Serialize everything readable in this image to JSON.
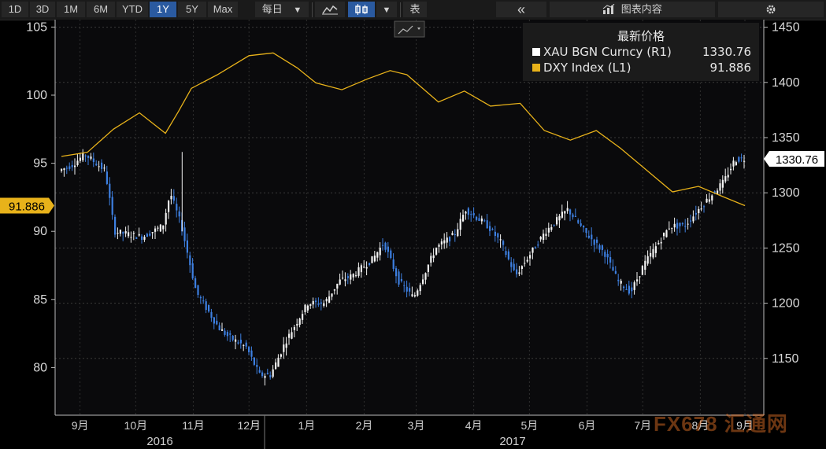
{
  "toolbar": {
    "ranges": [
      "1D",
      "3D",
      "1M",
      "6M",
      "YTD",
      "1Y",
      "5Y",
      "Max"
    ],
    "active_range": "1Y",
    "frequency": "每日",
    "dropdown_glyph": "▼",
    "table_label": "表",
    "collapse_glyph": "«",
    "chart_contents_label": "图表内容",
    "icons": [
      "line-chart-icon",
      "candlestick-icon",
      "chart-contents-icon",
      "settings-gear-icon"
    ]
  },
  "legend": {
    "title": "最新价格",
    "entries": [
      {
        "name": "XAU BGN Curncy  (R1)",
        "value": "1330.76",
        "color": "#ffffff"
      },
      {
        "name": "DXY Index  (L1)",
        "value": "91.886",
        "color": "#e8b21a"
      }
    ]
  },
  "watermark": "FX678 汇通网",
  "chart_data": {
    "type": "line",
    "left_axis": {
      "ticks": [
        80,
        85,
        90,
        95,
        100,
        105
      ],
      "range": [
        77,
        106
      ]
    },
    "right_axis": {
      "ticks": [
        1150,
        1200,
        1250,
        1300,
        1350,
        1400,
        1450
      ],
      "range": [
        1120,
        1460
      ]
    },
    "x_tick_labels": [
      "9月",
      "10月",
      "11月",
      "12月",
      "1月",
      "2月",
      "3月",
      "4月",
      "5月",
      "6月",
      "7月",
      "8月",
      "9月"
    ],
    "year_labels": [
      "2016",
      "2017"
    ],
    "left_last_label": "91.886",
    "right_last_label": "1330.76",
    "series": [
      {
        "name": "DXY Index  (L1)",
        "axis": "left",
        "color": "#e8b21a",
        "x": [
          "2016-09-05",
          "2016-09-19",
          "2016-10-03",
          "2016-10-17",
          "2016-10-31",
          "2016-11-07",
          "2016-11-14",
          "2016-11-28",
          "2016-12-15",
          "2016-12-28",
          "2017-01-10",
          "2017-01-20",
          "2017-02-03",
          "2017-02-17",
          "2017-03-01",
          "2017-03-10",
          "2017-03-27",
          "2017-04-10",
          "2017-04-24",
          "2017-05-10",
          "2017-05-23",
          "2017-06-06",
          "2017-06-20",
          "2017-07-03",
          "2017-07-17",
          "2017-07-31",
          "2017-08-14",
          "2017-08-28",
          "2017-09-08"
        ],
        "y": [
          95.5,
          95.8,
          97.5,
          98.7,
          97.2,
          98.8,
          100.5,
          101.5,
          102.9,
          103.1,
          102.0,
          100.9,
          100.4,
          101.2,
          101.8,
          101.5,
          99.5,
          100.3,
          99.2,
          99.4,
          97.4,
          96.7,
          97.4,
          96.1,
          94.5,
          92.9,
          93.3,
          92.5,
          91.886
        ]
      },
      {
        "name": "XAU BGN Curncy  (R1)",
        "axis": "right",
        "color": "#ffffff",
        "x": [
          "2016-09-05",
          "2016-09-12",
          "2016-09-19",
          "2016-09-30",
          "2016-10-05",
          "2016-10-20",
          "2016-10-31",
          "2016-11-04",
          "2016-11-10",
          "2016-11-18",
          "2016-11-30",
          "2016-12-05",
          "2016-12-15",
          "2016-12-22",
          "2016-12-28",
          "2017-01-05",
          "2017-01-17",
          "2017-01-26",
          "2017-02-03",
          "2017-02-10",
          "2017-02-21",
          "2017-02-27",
          "2017-03-07",
          "2017-03-15",
          "2017-03-27",
          "2017-04-06",
          "2017-04-12",
          "2017-04-24",
          "2017-05-01",
          "2017-05-09",
          "2017-05-17",
          "2017-05-25",
          "2017-06-06",
          "2017-06-15",
          "2017-06-26",
          "2017-07-03",
          "2017-07-10",
          "2017-07-17",
          "2017-07-31",
          "2017-08-08",
          "2017-08-18",
          "2017-08-29",
          "2017-09-04",
          "2017-09-08"
        ],
        "y": [
          1320,
          1325,
          1335,
          1320,
          1265,
          1260,
          1270,
          1300,
          1270,
          1210,
          1178,
          1170,
          1160,
          1135,
          1135,
          1165,
          1200,
          1200,
          1220,
          1225,
          1240,
          1255,
          1220,
          1205,
          1250,
          1262,
          1285,
          1270,
          1255,
          1225,
          1245,
          1265,
          1285,
          1265,
          1245,
          1220,
          1210,
          1235,
          1270,
          1270,
          1290,
          1310,
          1330,
          1330.76
        ]
      }
    ]
  }
}
